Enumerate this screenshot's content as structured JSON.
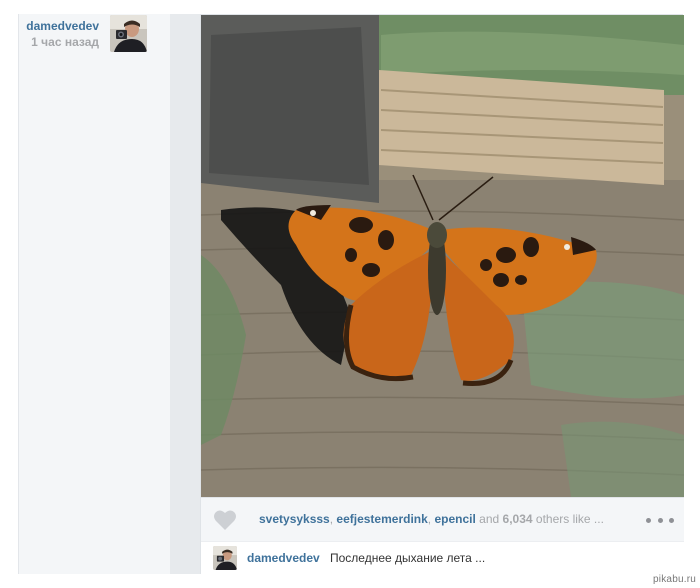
{
  "author": {
    "username": "damedvedev",
    "time": "1 час назад"
  },
  "likes": {
    "users": [
      "svetysyksss",
      "eefjestemerdink",
      "epencil"
    ],
    "separator": ", ",
    "and_word": " and ",
    "count": "6,034",
    "suffix": " others like ..."
  },
  "caption": {
    "username": "damedvedev",
    "text": "Последнее дыхание лета ..."
  },
  "icons": {
    "like": "heart-icon",
    "more": "more-dots-icon"
  },
  "colors": {
    "link": "#3f729b",
    "muted": "#a5a7aa",
    "panel": "#f4f6f8",
    "gutter": "#e7eaed"
  },
  "watermark": "pikabu.ru"
}
